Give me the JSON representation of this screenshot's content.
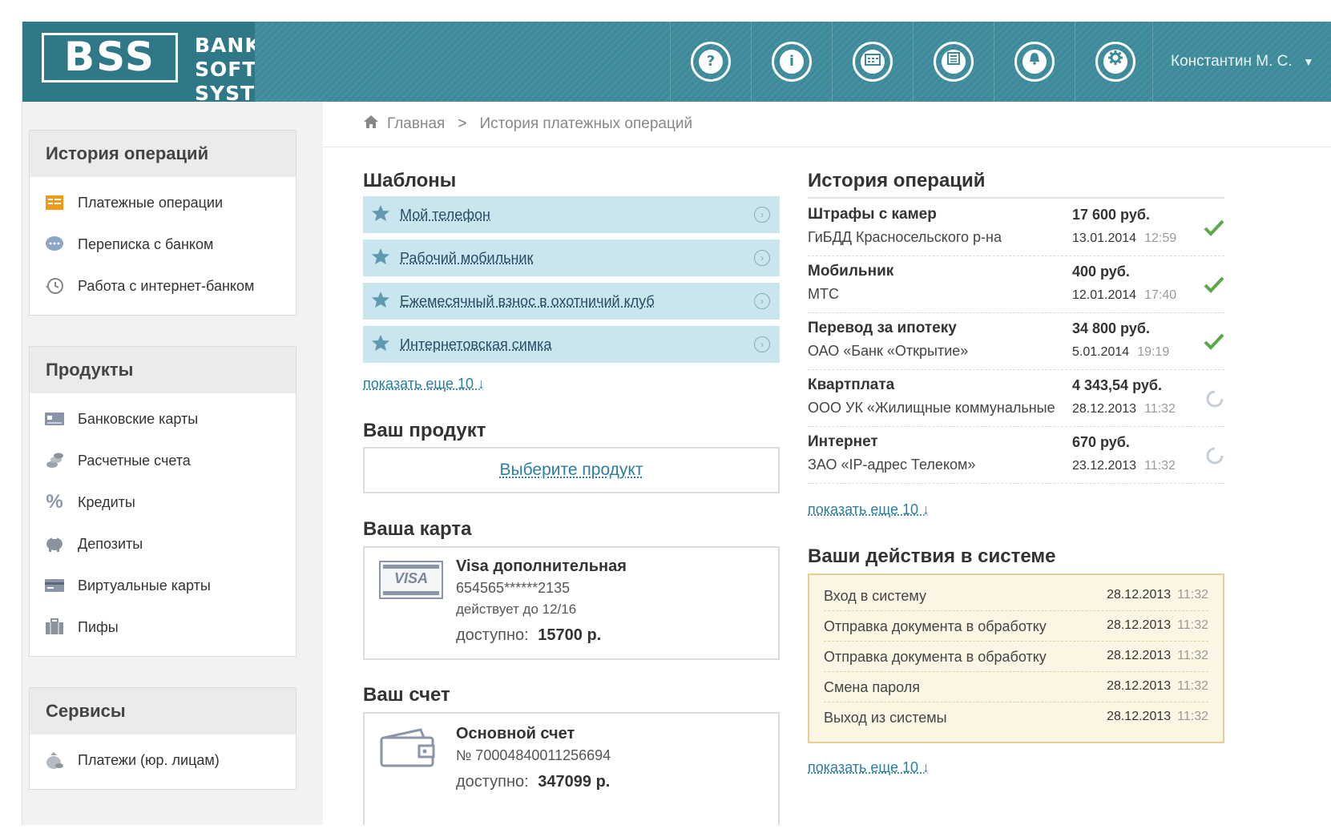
{
  "header": {
    "logo": "BSS",
    "brand_line1": "BANK SOFT",
    "brand_line2": "SYSTEMS",
    "icons": [
      "help-icon",
      "info-icon",
      "calendar-icon",
      "news-icon",
      "bell-icon",
      "settings-icon"
    ],
    "user": "Константин М. С.",
    "accent": "#3d8a9a"
  },
  "breadcrumb": {
    "home": "Главная",
    "current": "История платежных операций"
  },
  "sidebar": {
    "sections": [
      {
        "title": "История операций",
        "items": [
          {
            "label": "Платежные операции",
            "icon": "payment-doc-icon"
          },
          {
            "label": "Переписка с банком",
            "icon": "chat-icon"
          },
          {
            "label": "Работа с интернет-банком",
            "icon": "history-icon"
          }
        ]
      },
      {
        "title": "Продукты",
        "items": [
          {
            "label": "Банковские карты",
            "icon": "bank-card-icon"
          },
          {
            "label": "Расчетные счета",
            "icon": "coins-icon"
          },
          {
            "label": "Кредиты",
            "icon": "percent-icon"
          },
          {
            "label": "Депозиты",
            "icon": "piggy-bank-icon"
          },
          {
            "label": "Виртуальные карты",
            "icon": "virtual-card-icon"
          },
          {
            "label": "Пифы",
            "icon": "briefcase-icon"
          }
        ]
      },
      {
        "title": "Сервисы",
        "items": [
          {
            "label": "Платежи (юр. лицам)",
            "icon": "money-bag-icon"
          }
        ]
      }
    ]
  },
  "templates": {
    "title": "Шаблоны",
    "items": [
      "Мой телефон",
      "Рабочий мобильник",
      "Ежемесячный взнос в охотничий клуб",
      "Интернетовская симка"
    ],
    "more": "показать еще 10 ↓"
  },
  "product": {
    "title": "Ваш продукт",
    "choose": "Выберите продукт"
  },
  "card": {
    "title": "Ваша карта",
    "brand": "VISA",
    "name": "Visa дополнительная",
    "number": "654565******2135",
    "valid": "действует до 12/16",
    "avail_label": "доступно:",
    "avail_value": "15700 р."
  },
  "account": {
    "title": "Ваш счет",
    "name": "Основной счет",
    "number": "№ 70004840011256694",
    "avail_label": "доступно:",
    "avail_value": "347099 р."
  },
  "history": {
    "title": "История операций",
    "rows": [
      {
        "name": "Штрафы с камер",
        "sub": "ГиБДД Красносельского р-на",
        "amount": "17 600 руб.",
        "date": "13.01.2014",
        "time": "12:59",
        "status": "done"
      },
      {
        "name": "Мобильник",
        "sub": "МТС",
        "amount": "400 руб.",
        "date": "12.01.2014",
        "time": "17:40",
        "status": "done"
      },
      {
        "name": "Перевод за ипотеку",
        "sub": "ОАО «Банк «Открытие»",
        "amount": "34 800 руб.",
        "date": "5.01.2014",
        "time": "19:19",
        "status": "done"
      },
      {
        "name": "Квартплата",
        "sub": "ООО УК «Жилищные коммунальные",
        "amount": "4 343,54 руб.",
        "date": "28.12.2013",
        "time": "11:32",
        "status": "pending"
      },
      {
        "name": "Интернет",
        "sub": "ЗАО «IP-адрес Телеком»",
        "amount": "670 руб.",
        "date": "23.12.2013",
        "time": "11:32",
        "status": "pending"
      }
    ],
    "more": "показать еще 10 ↓"
  },
  "actions": {
    "title": "Ваши действия в системе",
    "rows": [
      {
        "name": "Вход в систему",
        "date": "28.12.2013",
        "time": "11:32"
      },
      {
        "name": "Отправка документа в обработку",
        "date": "28.12.2013",
        "time": "11:32"
      },
      {
        "name": "Отправка документа в обработку",
        "date": "28.12.2013",
        "time": "11:32"
      },
      {
        "name": "Смена пароля",
        "date": "28.12.2013",
        "time": "11:32"
      },
      {
        "name": "Выход из системы",
        "date": "28.12.2013",
        "time": "11:32"
      }
    ],
    "more": "показать еще 10 ↓"
  }
}
